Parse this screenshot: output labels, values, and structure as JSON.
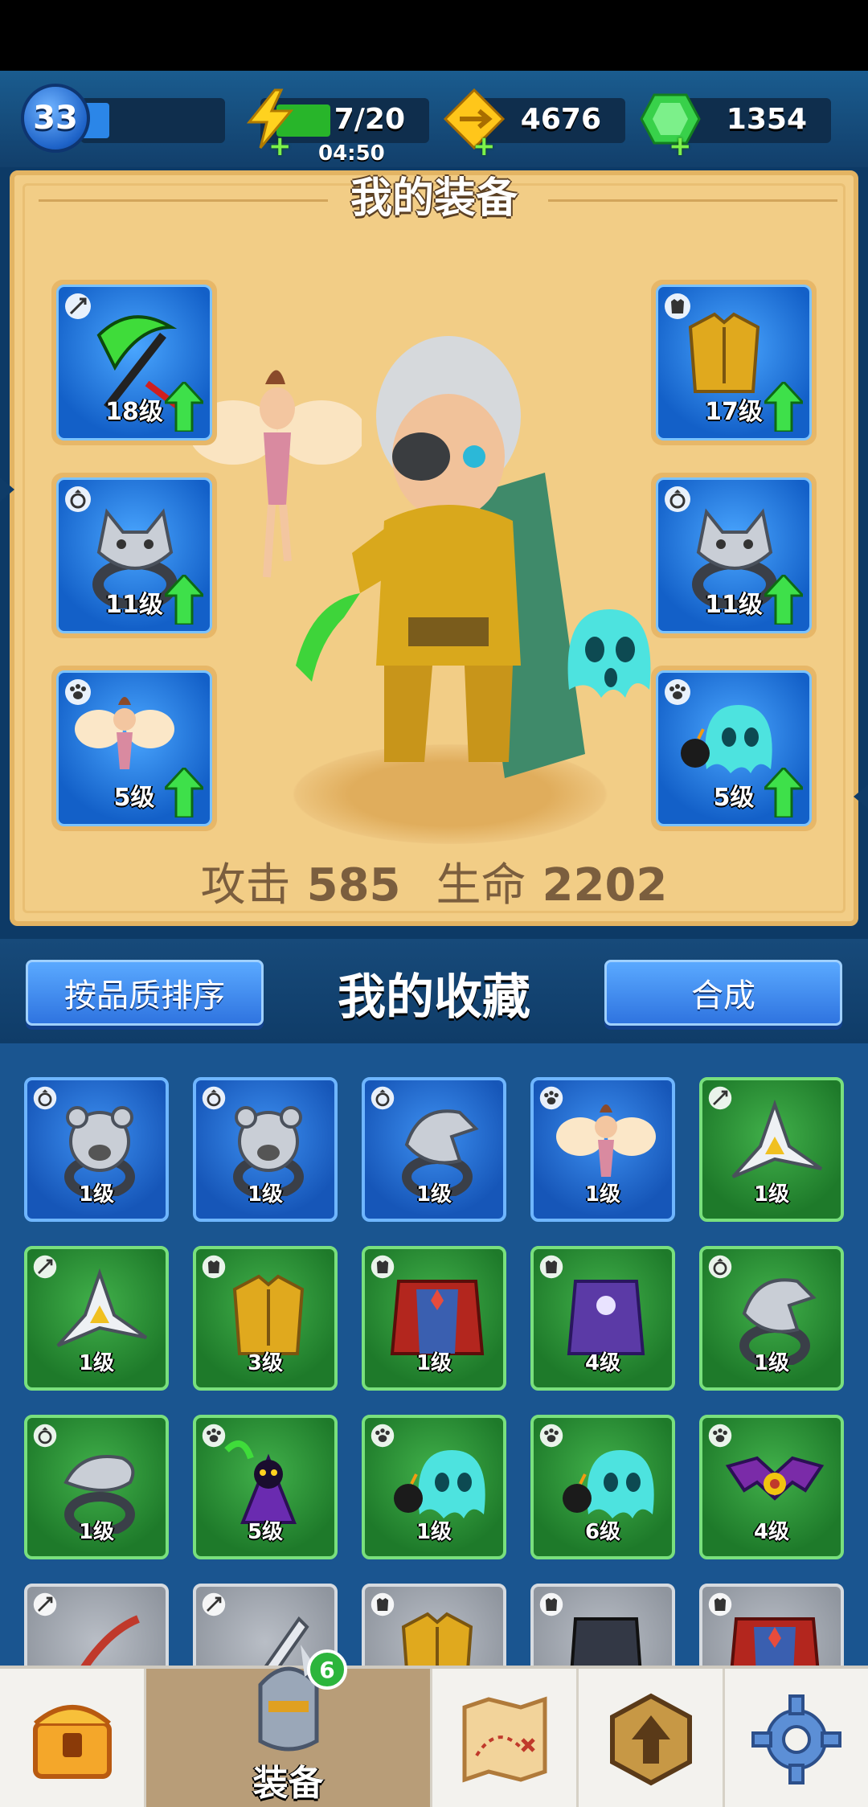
{
  "player": {
    "level": "33",
    "xp_fraction": 0.2
  },
  "resources": {
    "energy": "7/20",
    "energy_fraction": 0.35,
    "energy_timer": "04:50",
    "coins": "4676",
    "gems": "1354"
  },
  "equipment": {
    "title": "我的装备",
    "slots": [
      {
        "type": "weapon-icon",
        "level": "18级",
        "upgradable": true,
        "art": "green-scythe"
      },
      {
        "type": "ring-icon",
        "level": "11级",
        "upgradable": true,
        "art": "wolf-ring"
      },
      {
        "type": "pet-icon",
        "level": "5级",
        "upgradable": true,
        "art": "fairy"
      },
      {
        "type": "armor-icon",
        "level": "17级",
        "upgradable": true,
        "art": "gold-armor"
      },
      {
        "type": "ring-icon",
        "level": "11级",
        "upgradable": true,
        "art": "wolf-ring"
      },
      {
        "type": "pet-icon",
        "level": "5级",
        "upgradable": true,
        "art": "bomb-ghost"
      }
    ],
    "stats": {
      "attack_label": "攻击",
      "attack_value": "585",
      "hp_label": "生命",
      "hp_value": "2202"
    }
  },
  "collection": {
    "sort_button": "按品质排序",
    "title": "我的收藏",
    "merge_button": "合成",
    "items": [
      {
        "rarity": "blue",
        "type": "ring-icon",
        "level": "1级",
        "art": "bear-ring"
      },
      {
        "rarity": "blue",
        "type": "ring-icon",
        "level": "1级",
        "art": "bear-ring"
      },
      {
        "rarity": "blue",
        "type": "ring-icon",
        "level": "1级",
        "art": "eagle-ring"
      },
      {
        "rarity": "blue",
        "type": "pet-icon",
        "level": "1级",
        "art": "fairy"
      },
      {
        "rarity": "green",
        "type": "weapon-icon",
        "level": "1级",
        "art": "shuriken"
      },
      {
        "rarity": "green",
        "type": "weapon-icon",
        "level": "1级",
        "art": "shuriken"
      },
      {
        "rarity": "green",
        "type": "armor-icon",
        "level": "3级",
        "art": "gold-armor"
      },
      {
        "rarity": "green",
        "type": "armor-icon",
        "level": "1级",
        "art": "red-cape"
      },
      {
        "rarity": "green",
        "type": "armor-icon",
        "level": "4级",
        "art": "purple-robe"
      },
      {
        "rarity": "green",
        "type": "ring-icon",
        "level": "1级",
        "art": "eagle-ring"
      },
      {
        "rarity": "green",
        "type": "ring-icon",
        "level": "1级",
        "art": "snake-ring"
      },
      {
        "rarity": "green",
        "type": "pet-icon",
        "level": "5级",
        "art": "reaper"
      },
      {
        "rarity": "green",
        "type": "pet-icon",
        "level": "1级",
        "art": "bomb-ghost"
      },
      {
        "rarity": "green",
        "type": "pet-icon",
        "level": "6级",
        "art": "bomb-ghost"
      },
      {
        "rarity": "green",
        "type": "pet-icon",
        "level": "4级",
        "art": "bat-eye"
      },
      {
        "rarity": "gray",
        "type": "weapon-icon",
        "level": "",
        "art": "red-bow"
      },
      {
        "rarity": "gray",
        "type": "weapon-icon",
        "level": "",
        "art": "sword"
      },
      {
        "rarity": "gray",
        "type": "armor-icon",
        "level": "",
        "art": "gold-armor"
      },
      {
        "rarity": "gray",
        "type": "armor-icon",
        "level": "",
        "art": "dark-robe"
      },
      {
        "rarity": "gray",
        "type": "armor-icon",
        "level": "",
        "art": "red-cape"
      }
    ]
  },
  "nav": {
    "items": [
      {
        "name": "chest-icon",
        "label": ""
      },
      {
        "name": "armor-helmet-icon",
        "label": "装备",
        "badge": "6",
        "active": true
      },
      {
        "name": "map-icon",
        "label": ""
      },
      {
        "name": "upgrade-icon",
        "label": ""
      },
      {
        "name": "settings-gear-icon",
        "label": ""
      }
    ]
  }
}
